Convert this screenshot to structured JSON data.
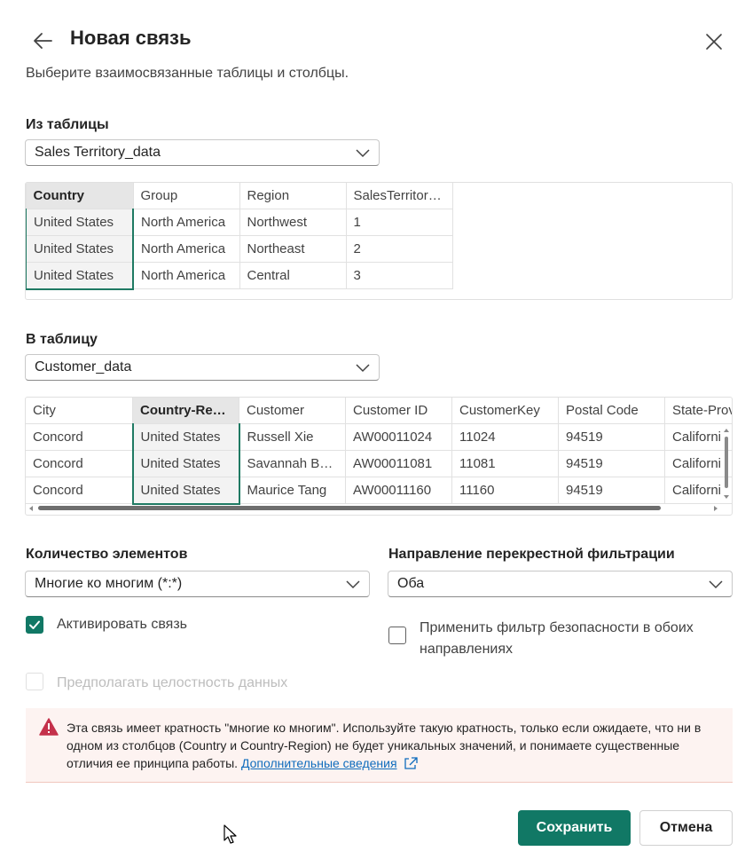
{
  "dialog": {
    "title": "Новая связь",
    "subtitle": "Выберите взаимосвязанные таблицы и столбцы."
  },
  "from_table": {
    "label": "Из таблицы",
    "selected": "Sales Territory_data",
    "columns": [
      "Country",
      "Group",
      "Region",
      "SalesTerritory..."
    ],
    "selected_column": "Country",
    "rows": [
      [
        "United States",
        "North America",
        "Northwest",
        "1"
      ],
      [
        "United States",
        "North America",
        "Northeast",
        "2"
      ],
      [
        "United States",
        "North America",
        "Central",
        "3"
      ]
    ]
  },
  "to_table": {
    "label": "В таблицу",
    "selected": "Customer_data",
    "columns": [
      "City",
      "Country-Regi...",
      "Customer",
      "Customer ID",
      "CustomerKey",
      "Postal Code",
      "State-Prov"
    ],
    "selected_column": "Country-Regi...",
    "rows": [
      [
        "Concord",
        "United States",
        "Russell Xie",
        "AW00011024",
        "11024",
        "94519",
        "Californi"
      ],
      [
        "Concord",
        "United States",
        "Savannah Bak...",
        "AW00011081",
        "11081",
        "94519",
        "Californi"
      ],
      [
        "Concord",
        "United States",
        "Maurice Tang",
        "AW00011160",
        "11160",
        "94519",
        "Californi"
      ]
    ]
  },
  "cardinality": {
    "label": "Количество элементов",
    "selected": "Многие ко многим (*:*)"
  },
  "cross_filter": {
    "label": "Направление перекрестной фильтрации",
    "selected": "Оба"
  },
  "options": {
    "activate_label": "Активировать связь",
    "activate_checked": true,
    "security_filter_label_line1": "Применить фильтр безопасности в обоих",
    "security_filter_label_line2": "направлениях",
    "security_filter_checked": false,
    "integrity_label": "Предполагать целостность данных",
    "integrity_disabled": true
  },
  "warning": {
    "text": "Эта связь имеет кратность \"многие ко многим\". Используйте такую кратность, только если ожидаете, что ни в одном из столбцов (Country и Country-Region) не будет уникальных значений, и понимаете существенные отличия ее принципа работы. ",
    "link": "Дополнительные сведения"
  },
  "buttons": {
    "save": "Сохранить",
    "cancel": "Отмена"
  },
  "colors": {
    "accent": "#117865",
    "warning_bg": "#fdf3f1",
    "warning_icon": "#c4314b",
    "link": "#0f6cbd"
  }
}
